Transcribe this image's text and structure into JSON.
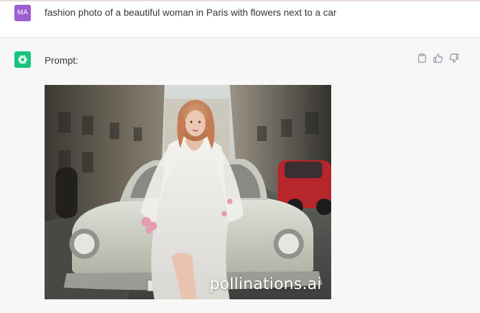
{
  "user_message": {
    "avatar_initials": "MA",
    "avatar_color": "#9c5ed1",
    "text": "fashion photo of a beautiful woman in Paris with flowers next to a car"
  },
  "assistant_message": {
    "avatar_icon": "openai-logo-icon",
    "avatar_color": "#19c37d",
    "label": "Prompt:",
    "actions": [
      "copy-icon",
      "thumbs-up-icon",
      "thumbs-down-icon"
    ],
    "image": {
      "description_icon": "generated-image",
      "watermark": "pollinations.ai"
    }
  }
}
